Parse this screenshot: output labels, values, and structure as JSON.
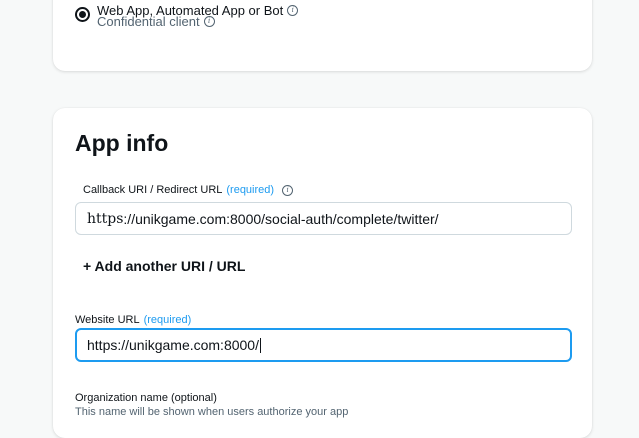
{
  "top_card": {
    "radio_title": "Web App, Automated App or Bot",
    "radio_subtitle": "Confidential client",
    "info_glyph": "i"
  },
  "app_info": {
    "title": "App info",
    "callback": {
      "label": "Callback URI / Redirect URL",
      "required": "(required)",
      "value_scheme": "https",
      "value_rest": "://unikgame.com:8000/social-auth/complete/twitter/"
    },
    "add_uri_label": "+ Add another URI / URL",
    "website": {
      "label": "Website URL",
      "required": "(required)",
      "value": "https://unikgame.com:8000/"
    },
    "organization": {
      "label": "Organization name (optional)",
      "help": "This name will be shown when users authorize your app"
    }
  },
  "colors": {
    "accent": "#1d9bf0",
    "text": "#0f1419",
    "muted": "#536471",
    "border": "#cfd9de",
    "background": "#f7f9f9"
  },
  "icons": {
    "info": "info-icon",
    "radio": "radio-selected-icon"
  }
}
